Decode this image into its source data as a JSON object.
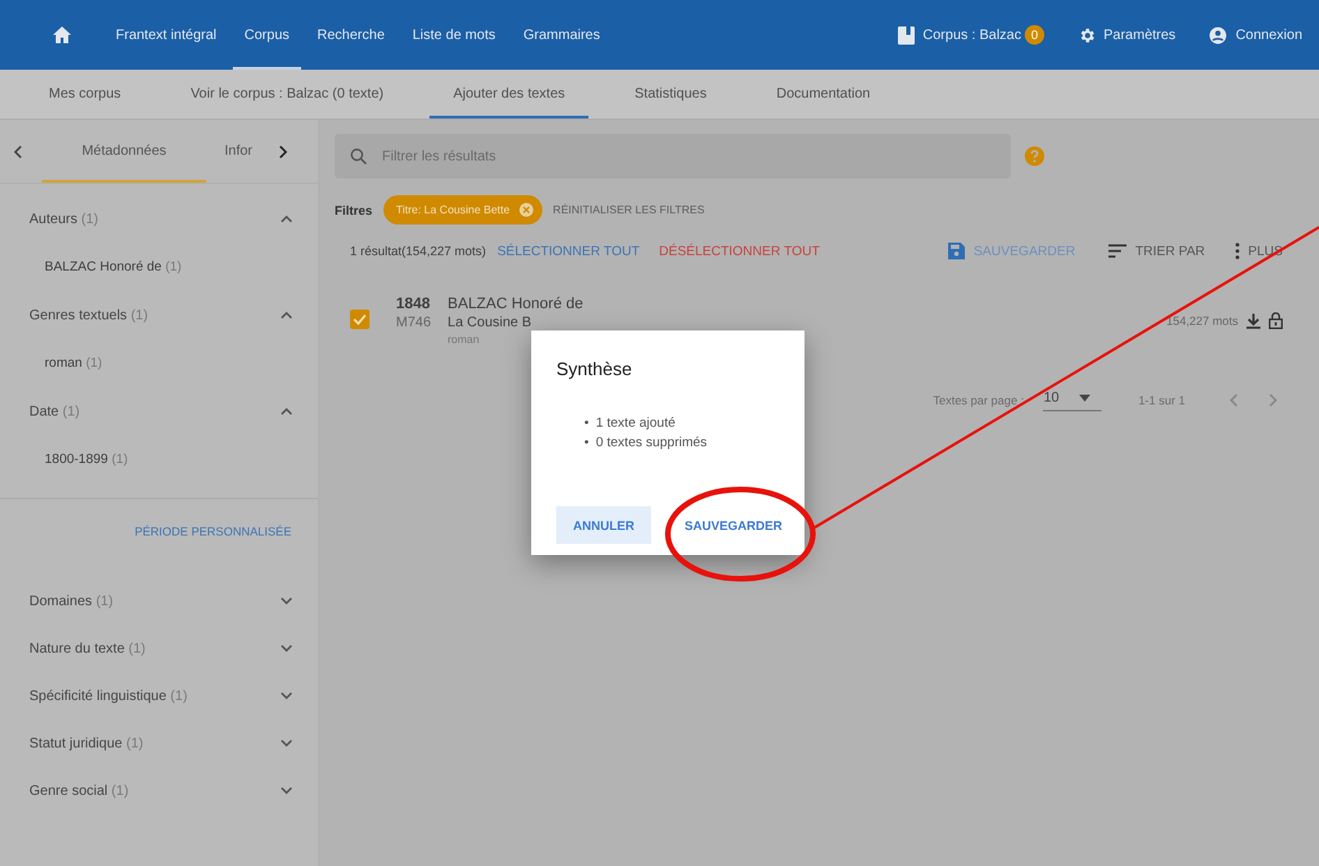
{
  "nav": {
    "items": [
      {
        "label": "Frantext intégral",
        "selected": false
      },
      {
        "label": "Corpus",
        "selected": true
      },
      {
        "label": "Recherche",
        "selected": false
      },
      {
        "label": "Liste de mots",
        "selected": false
      },
      {
        "label": "Grammaires",
        "selected": false
      }
    ],
    "corpus": {
      "label": "Corpus : Balzac",
      "badge": "0"
    },
    "settings": "Paramètres",
    "login": "Connexion"
  },
  "subtabs": [
    {
      "label": "Mes corpus",
      "selected": false
    },
    {
      "label": "Voir le corpus : Balzac (0 texte)",
      "selected": false
    },
    {
      "label": "Ajouter des textes",
      "selected": true
    },
    {
      "label": "Statistiques",
      "selected": false
    },
    {
      "label": "Documentation",
      "selected": false
    }
  ],
  "sidebar": {
    "tabs": [
      {
        "label": "Métadonnées",
        "selected": true
      },
      {
        "label": "Infor",
        "selected": false
      }
    ],
    "groups": [
      {
        "facets": [
          {
            "label": "Auteurs",
            "count": "(1)",
            "expanded": true,
            "items": [
              {
                "label": "BALZAC Honoré de",
                "count": "(1)"
              }
            ]
          },
          {
            "label": "Genres textuels",
            "count": "(1)",
            "expanded": true,
            "items": [
              {
                "label": "roman",
                "count": "(1)"
              }
            ]
          },
          {
            "label": "Date",
            "count": "(1)",
            "expanded": true,
            "items": [
              {
                "label": "1800-1899",
                "count": "(1)"
              }
            ]
          }
        ],
        "link": "PÉRIODE PERSONNALISÉE"
      },
      {
        "facets": [
          {
            "label": "Domaines",
            "count": "(1)",
            "expanded": false
          },
          {
            "label": "Nature du texte",
            "count": "(1)",
            "expanded": false
          },
          {
            "label": "Spécificité linguistique",
            "count": "(1)",
            "expanded": false
          },
          {
            "label": "Statut juridique",
            "count": "(1)",
            "expanded": false
          },
          {
            "label": "Genre social",
            "count": "(1)",
            "expanded": false
          }
        ]
      }
    ]
  },
  "search": {
    "placeholder": "Filtrer les résultats"
  },
  "filters": {
    "label": "Filtres",
    "chips": [
      "Titre: La Cousine Bette"
    ],
    "reset": "RÉINITIALISER LES FILTRES"
  },
  "toolbar": {
    "summary": "1 résultat(154,227 mots)",
    "select_all": "SÉLECTIONNER TOUT",
    "deselect_all": "DÉSÉLECTIONNER TOUT",
    "save": "SAUVEGARDER",
    "sort": "TRIER PAR",
    "more": "PLUS"
  },
  "results": [
    {
      "checked": true,
      "year": "1848",
      "id": "M746",
      "author": "BALZAC Honoré de",
      "title": "La Cousine B",
      "genre": "roman",
      "words": "154,227 mots"
    }
  ],
  "pagination": {
    "label": "Textes par page :",
    "per_page": "10",
    "range": "1-1 sur 1"
  },
  "dialog": {
    "title": "Synthèse",
    "bullet": "•",
    "lines": [
      "1 texte ajouté",
      "0 textes supprimés"
    ],
    "buttons": [
      {
        "label": "ANNULER",
        "kind": "tonal"
      },
      {
        "label": "SAUVEGARDER",
        "kind": "text"
      }
    ]
  }
}
